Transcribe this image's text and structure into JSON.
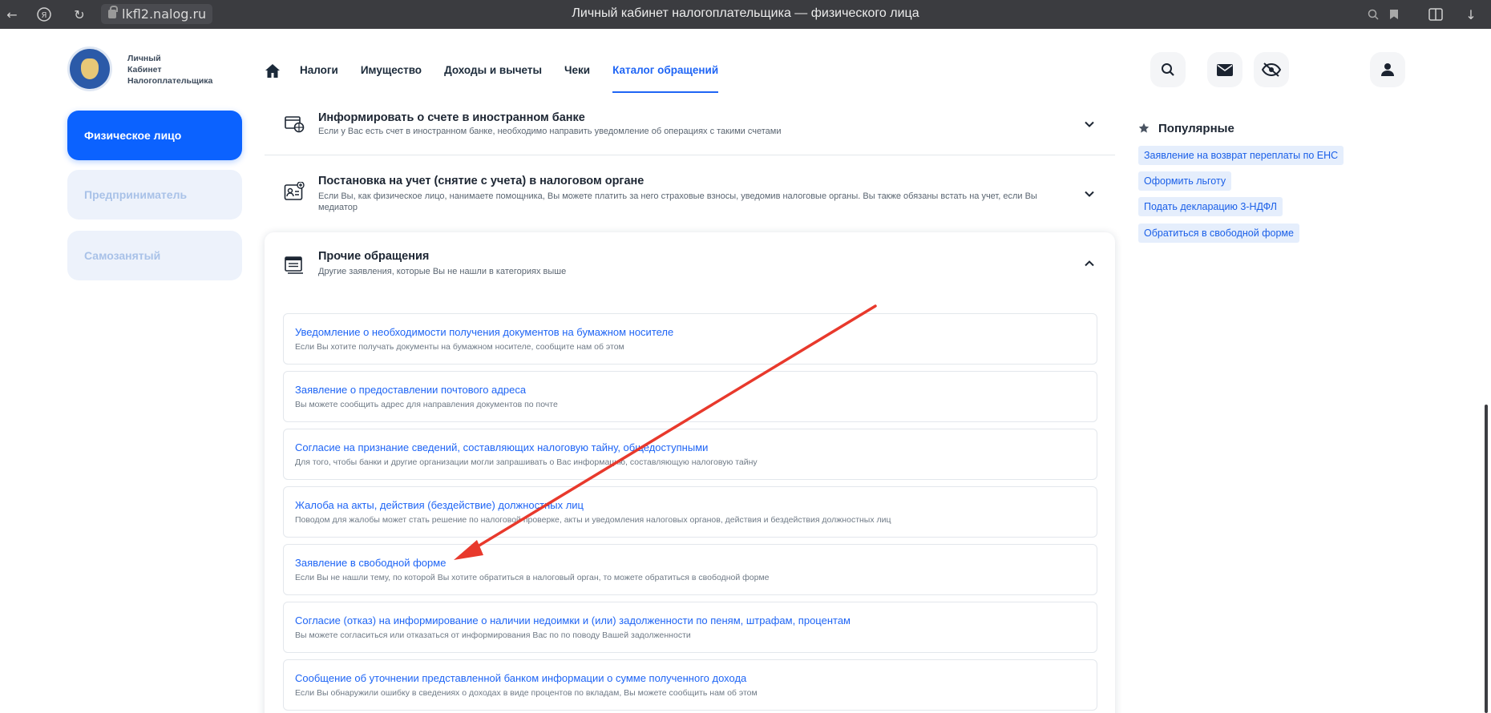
{
  "browser": {
    "url": "lkfl2.nalog.ru",
    "window_title": "Личный кабинет налогоплательщика — физического лица",
    "icons": [
      "back-arrow-icon",
      "yandex-icon",
      "reload-icon",
      "lock-icon",
      "search-chat-icon",
      "bookmark-icon",
      "reading-mode-icon",
      "extensions-icon",
      "download-icon"
    ]
  },
  "logo": {
    "line1": "Личный",
    "line2": "Кабинет",
    "line3": "Налогоплательщика"
  },
  "nav": {
    "home_icon": "home-icon",
    "items": [
      "Налоги",
      "Имущество",
      "Доходы и вычеты",
      "Чеки",
      "Каталог обращений"
    ],
    "active_item": "Каталог обращений"
  },
  "header_icons": [
    "search-icon",
    "envelope-icon",
    "eye-crossed-icon",
    "user-icon"
  ],
  "sidebar": {
    "items": [
      {
        "label": "Физическое лицо",
        "active": true
      },
      {
        "label": "Предприниматель",
        "active": false
      },
      {
        "label": "Самозанятый",
        "active": false
      }
    ]
  },
  "sections": [
    {
      "title": "Информировать о счете в иностранном банке",
      "description": "Если у Вас есть счет в иностранном банке, необходимо направить уведомление об операциях с такими счетами",
      "icon": "foreign-bank-icon",
      "expanded": false
    },
    {
      "title": "Постановка на учет (снятие с учета) в налоговом органе",
      "description": "Если Вы, как физическое лицо, нанимаете помощника, Вы можете платить за него страховые взносы, уведомив налоговые органы. Вы также обязаны встать на учет, если Вы медиатор",
      "icon": "registration-card-icon",
      "expanded": false
    },
    {
      "title": "Прочие обращения",
      "description": "Другие заявления, которые Вы не нашли в категориях выше",
      "icon": "documents-icon",
      "expanded": true
    }
  ],
  "requests": [
    {
      "title": "Уведомление о необходимости получения документов на бумажном носителе",
      "description": "Если Вы хотите получать документы на бумажном носителе, сообщите нам об этом"
    },
    {
      "title": "Заявление о предоставлении почтового адреса",
      "description": "Вы можете сообщить адрес для направления документов по почте"
    },
    {
      "title": "Согласие на признание сведений, составляющих налоговую тайну, общедоступными",
      "description": "Для того, чтобы банки и другие организации могли запрашивать о Вас информацию, составляющую налоговую тайну"
    },
    {
      "title": "Жалоба на акты, действия (бездействие) должностных лиц",
      "description": "Поводом для жалобы может стать решение по налоговой проверке, акты и уведомления налоговых органов, действия и бездействия должностных лиц"
    },
    {
      "title": "Заявление в свободной форме",
      "description": "Если Вы не нашли тему, по которой Вы хотите обратиться в налоговый орган, то можете обратиться в свободной форме"
    },
    {
      "title": "Согласие (отказ) на информирование о наличии недоимки и (или) задолженности по пеням, штрафам, процентам",
      "description": "Вы можете согласиться или отказаться от информирования Вас по по поводу Вашей задолженности"
    },
    {
      "title": "Сообщение об уточнении представленной банком информации о сумме полученного дохода",
      "description": "Если Вы обнаружили ошибку в сведениях о доходах в виде процентов по вкладам, Вы можете сообщить нам об этом"
    }
  ],
  "popular": {
    "title": "Популярные",
    "icon": "star-icon",
    "items": [
      "Заявление на возврат переплаты по ЕНС",
      "Оформить льготу",
      "Подать декларацию 3-НДФЛ",
      "Обратиться в свободной форме"
    ]
  },
  "annotation": {
    "type": "red-arrow",
    "color": "#e8392c",
    "target": "Заявление в свободной форме"
  },
  "colors": {
    "accent": "#1f65f5",
    "sidebar_active": "#0b62ff",
    "sidebar_inactive_bg": "#edf2fb",
    "arrow": "#e8392c"
  }
}
